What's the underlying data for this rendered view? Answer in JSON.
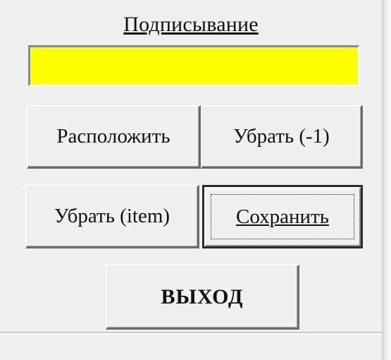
{
  "window": {
    "title": "Подписывание"
  },
  "signing_field": {
    "value": "",
    "color": "#ffff00"
  },
  "buttons": {
    "arrange": "Расположить",
    "remove_last": "Убрать (-1)",
    "remove_item": "Убрать (item)",
    "save": "Сохранить",
    "exit": "ВЫХОД"
  }
}
